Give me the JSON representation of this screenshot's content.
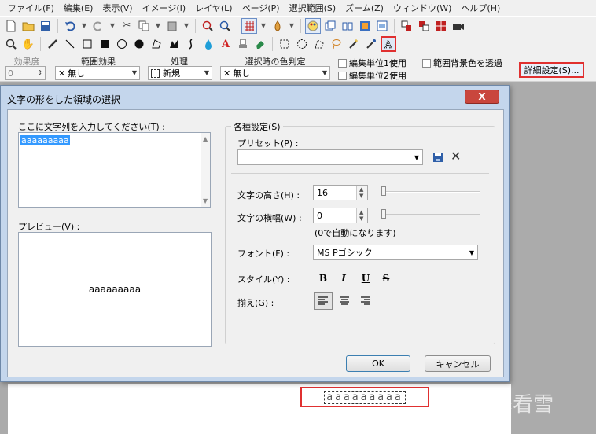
{
  "menubar": {
    "items": [
      "ファイル(F)",
      "編集(E)",
      "表示(V)",
      "イメージ(I)",
      "レイヤ(L)",
      "ページ(P)",
      "選択範囲(S)",
      "ズーム(Z)",
      "ウィンドウ(W)",
      "ヘルプ(H)"
    ]
  },
  "optionsbar": {
    "effect_strength_label": "効果度",
    "effect_strength_value": "0",
    "range_effect_label": "範囲効果",
    "range_effect_value": "無し",
    "process_label": "処理",
    "process_value": "新規",
    "select_color_label": "選択時の色判定",
    "select_color_value": "無し",
    "use_unit1_label": "編集単位1使用",
    "use_unit2_label": "編集単位2使用",
    "transparent_bg_label": "範囲背景色を透過",
    "detail_button": "詳細設定(S)..."
  },
  "dialog": {
    "title": "文字の形をした領域の選択",
    "close_label": "X",
    "text_input_label": "ここに文字列を入力してください(T) :",
    "text_input_value": "aaaaaaaaa",
    "preview_label": "プレビュー(V) :",
    "preview_text": "aaaaaaaaa",
    "settings_group_label": "各種設定(S)",
    "preset_label": "プリセット(P) :",
    "preset_value": "",
    "height_label": "文字の高さ(H) :",
    "height_value": "16",
    "width_label": "文字の横幅(W) :",
    "width_value": "0",
    "width_note": "(0で自動になります)",
    "font_label": "フォント(F) :",
    "font_value": "MS Pゴシック",
    "style_label": "スタイル(Y) :",
    "style_bold": "B",
    "style_italic": "I",
    "style_underline": "U",
    "style_strike": "S",
    "align_label": "揃え(G) :",
    "ok_label": "OK",
    "cancel_label": "キャンセル"
  },
  "canvas": {
    "selection_text": "aaaaaaaaa"
  },
  "watermark": "看雪",
  "colors": {
    "highlight_red": "#e03030",
    "selection_blue": "#3399ff",
    "dialog_frame": "#c4d6ec",
    "close_red": "#c9463d"
  }
}
